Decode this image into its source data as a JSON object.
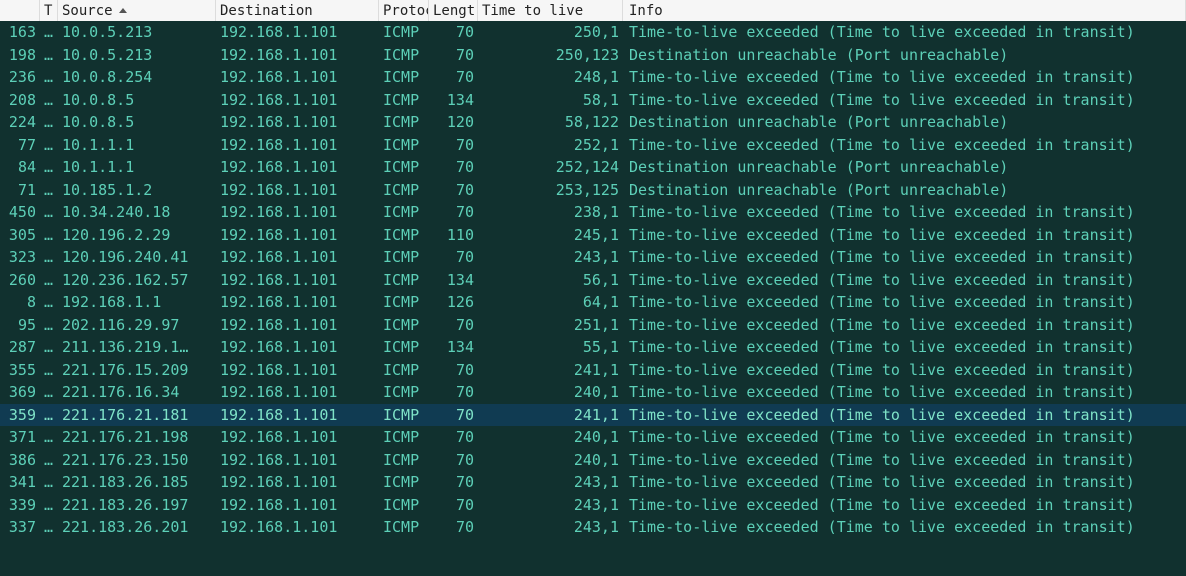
{
  "columns": {
    "num_blank": "",
    "t": "T",
    "source": "Source",
    "destination": "Destination",
    "protocol": "Protoc",
    "length": "Lengt",
    "ttl": "Time to live",
    "info": "Info"
  },
  "sort_column": "source",
  "selected_index": 17,
  "rows": [
    {
      "num": "163",
      "t": "…",
      "src": "10.0.5.213",
      "dst": "192.168.1.101",
      "proto": "ICMP",
      "len": "70",
      "ttl": "250,1",
      "info": "Time-to-live exceeded (Time to live exceeded in transit)"
    },
    {
      "num": "198",
      "t": "…",
      "src": "10.0.5.213",
      "dst": "192.168.1.101",
      "proto": "ICMP",
      "len": "70",
      "ttl": "250,123",
      "info": "Destination unreachable (Port unreachable)"
    },
    {
      "num": "236",
      "t": "…",
      "src": "10.0.8.254",
      "dst": "192.168.1.101",
      "proto": "ICMP",
      "len": "70",
      "ttl": "248,1",
      "info": "Time-to-live exceeded (Time to live exceeded in transit)"
    },
    {
      "num": "208",
      "t": "…",
      "src": "10.0.8.5",
      "dst": "192.168.1.101",
      "proto": "ICMP",
      "len": "134",
      "ttl": "58,1",
      "info": "Time-to-live exceeded (Time to live exceeded in transit)"
    },
    {
      "num": "224",
      "t": "…",
      "src": "10.0.8.5",
      "dst": "192.168.1.101",
      "proto": "ICMP",
      "len": "120",
      "ttl": "58,122",
      "info": "Destination unreachable (Port unreachable)"
    },
    {
      "num": "77",
      "t": "…",
      "src": "10.1.1.1",
      "dst": "192.168.1.101",
      "proto": "ICMP",
      "len": "70",
      "ttl": "252,1",
      "info": "Time-to-live exceeded (Time to live exceeded in transit)"
    },
    {
      "num": "84",
      "t": "…",
      "src": "10.1.1.1",
      "dst": "192.168.1.101",
      "proto": "ICMP",
      "len": "70",
      "ttl": "252,124",
      "info": "Destination unreachable (Port unreachable)"
    },
    {
      "num": "71",
      "t": "…",
      "src": "10.185.1.2",
      "dst": "192.168.1.101",
      "proto": "ICMP",
      "len": "70",
      "ttl": "253,125",
      "info": "Destination unreachable (Port unreachable)"
    },
    {
      "num": "450",
      "t": "…",
      "src": "10.34.240.18",
      "dst": "192.168.1.101",
      "proto": "ICMP",
      "len": "70",
      "ttl": "238,1",
      "info": "Time-to-live exceeded (Time to live exceeded in transit)"
    },
    {
      "num": "305",
      "t": "…",
      "src": "120.196.2.29",
      "dst": "192.168.1.101",
      "proto": "ICMP",
      "len": "110",
      "ttl": "245,1",
      "info": "Time-to-live exceeded (Time to live exceeded in transit)"
    },
    {
      "num": "323",
      "t": "…",
      "src": "120.196.240.41",
      "dst": "192.168.1.101",
      "proto": "ICMP",
      "len": "70",
      "ttl": "243,1",
      "info": "Time-to-live exceeded (Time to live exceeded in transit)"
    },
    {
      "num": "260",
      "t": "…",
      "src": "120.236.162.57",
      "dst": "192.168.1.101",
      "proto": "ICMP",
      "len": "134",
      "ttl": "56,1",
      "info": "Time-to-live exceeded (Time to live exceeded in transit)"
    },
    {
      "num": "8",
      "t": "…",
      "src": "192.168.1.1",
      "dst": "192.168.1.101",
      "proto": "ICMP",
      "len": "126",
      "ttl": "64,1",
      "info": "Time-to-live exceeded (Time to live exceeded in transit)"
    },
    {
      "num": "95",
      "t": "…",
      "src": "202.116.29.97",
      "dst": "192.168.1.101",
      "proto": "ICMP",
      "len": "70",
      "ttl": "251,1",
      "info": "Time-to-live exceeded (Time to live exceeded in transit)"
    },
    {
      "num": "287",
      "t": "…",
      "src": "211.136.219.1…",
      "dst": "192.168.1.101",
      "proto": "ICMP",
      "len": "134",
      "ttl": "55,1",
      "info": "Time-to-live exceeded (Time to live exceeded in transit)"
    },
    {
      "num": "355",
      "t": "…",
      "src": "221.176.15.209",
      "dst": "192.168.1.101",
      "proto": "ICMP",
      "len": "70",
      "ttl": "241,1",
      "info": "Time-to-live exceeded (Time to live exceeded in transit)"
    },
    {
      "num": "369",
      "t": "…",
      "src": "221.176.16.34",
      "dst": "192.168.1.101",
      "proto": "ICMP",
      "len": "70",
      "ttl": "240,1",
      "info": "Time-to-live exceeded (Time to live exceeded in transit)"
    },
    {
      "num": "359",
      "t": "…",
      "src": "221.176.21.181",
      "dst": "192.168.1.101",
      "proto": "ICMP",
      "len": "70",
      "ttl": "241,1",
      "info": "Time-to-live exceeded (Time to live exceeded in transit)"
    },
    {
      "num": "371",
      "t": "…",
      "src": "221.176.21.198",
      "dst": "192.168.1.101",
      "proto": "ICMP",
      "len": "70",
      "ttl": "240,1",
      "info": "Time-to-live exceeded (Time to live exceeded in transit)"
    },
    {
      "num": "386",
      "t": "…",
      "src": "221.176.23.150",
      "dst": "192.168.1.101",
      "proto": "ICMP",
      "len": "70",
      "ttl": "240,1",
      "info": "Time-to-live exceeded (Time to live exceeded in transit)"
    },
    {
      "num": "341",
      "t": "…",
      "src": "221.183.26.185",
      "dst": "192.168.1.101",
      "proto": "ICMP",
      "len": "70",
      "ttl": "243,1",
      "info": "Time-to-live exceeded (Time to live exceeded in transit)"
    },
    {
      "num": "339",
      "t": "…",
      "src": "221.183.26.197",
      "dst": "192.168.1.101",
      "proto": "ICMP",
      "len": "70",
      "ttl": "243,1",
      "info": "Time-to-live exceeded (Time to live exceeded in transit)"
    },
    {
      "num": "337",
      "t": "…",
      "src": "221.183.26.201",
      "dst": "192.168.1.101",
      "proto": "ICMP",
      "len": "70",
      "ttl": "243,1",
      "info": "Time-to-live exceeded (Time to live exceeded in transit)"
    }
  ]
}
